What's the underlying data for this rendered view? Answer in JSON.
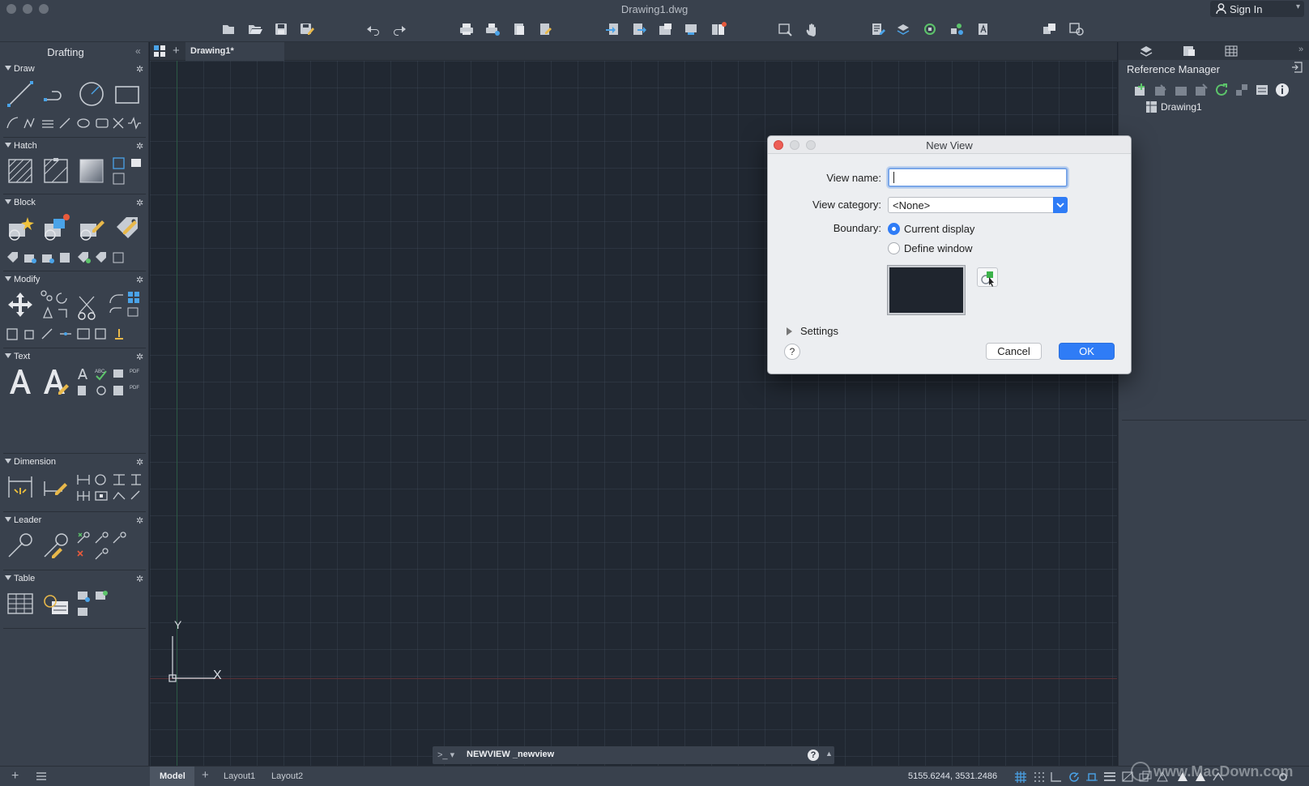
{
  "window": {
    "title": "Drawing1.dwg",
    "sign_in": "Sign In"
  },
  "toolbar": {
    "icons": [
      "new-file-icon",
      "open-folder-icon",
      "save-icon",
      "save-as-icon",
      "undo-icon",
      "redo-icon",
      "plot-icon",
      "batch-plot-icon",
      "plot-preview-icon",
      "publish-icon",
      "import-icon",
      "export-icon",
      "attach-icon",
      "xref-icon",
      "reference-manager-icon",
      "zoom-window-icon",
      "pan-icon",
      "properties-icon",
      "layer-icon",
      "match-properties-icon",
      "block-editor-icon",
      "markup-icon",
      "sheet-set-icon",
      "render-icon"
    ]
  },
  "palette": {
    "title": "Drafting",
    "sections": [
      {
        "name": "Draw"
      },
      {
        "name": "Hatch"
      },
      {
        "name": "Block"
      },
      {
        "name": "Modify"
      },
      {
        "name": "Text"
      },
      {
        "name": "Dimension"
      },
      {
        "name": "Leader"
      },
      {
        "name": "Table"
      }
    ]
  },
  "tabs": {
    "document": "Drawing1*"
  },
  "canvas": {
    "ucs_y": "Y",
    "ucs_x": "X"
  },
  "command": {
    "prompt": ">_ ▾",
    "text": "NEWVIEW _newview",
    "help": "?"
  },
  "right_panel": {
    "title": "Reference Manager",
    "tree": [
      {
        "label": "Drawing1"
      }
    ]
  },
  "statusbar": {
    "model": "Model",
    "layouts": [
      "Layout1",
      "Layout2"
    ],
    "coords": "5155.6244, 3531.2486"
  },
  "watermark": "www.MacDown.com",
  "dialog": {
    "title": "New View",
    "view_name_label": "View name:",
    "view_name_value": "",
    "view_category_label": "View category:",
    "view_category_value": "<None>",
    "boundary_label": "Boundary:",
    "boundary_options": [
      {
        "label": "Current display",
        "selected": true
      },
      {
        "label": "Define window",
        "selected": false
      }
    ],
    "settings_label": "Settings",
    "help_label": "?",
    "cancel_label": "Cancel",
    "ok_label": "OK"
  },
  "colors": {
    "accent": "#2f7cf6",
    "canvas": "#212832",
    "panel": "#39414d",
    "close": "#ed5d55"
  }
}
